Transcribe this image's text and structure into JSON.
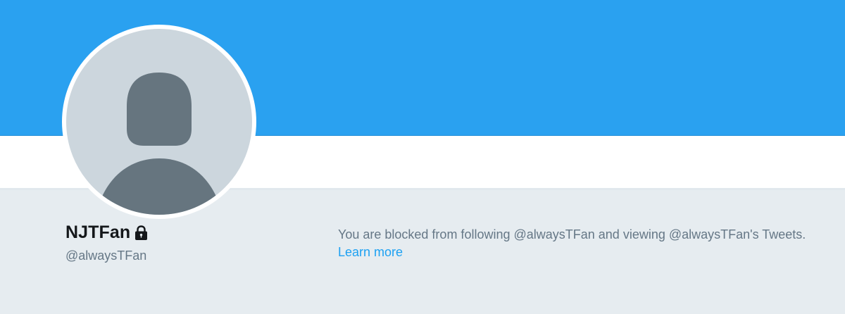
{
  "profile": {
    "name": "NJTFan",
    "handle": "@alwaysTFan",
    "protected_icon": "lock-icon",
    "avatar_icon": "default-profile-silhouette"
  },
  "blocked": {
    "message": "You are blocked from following @alwaysTFan and viewing @alwaysTFan's Tweets. ",
    "link_label": "Learn more"
  },
  "colors": {
    "banner": "#2aa1f0",
    "background": "#e6ecf0",
    "avatar_bg": "#ccd6dd",
    "silhouette": "#66757f",
    "link": "#1da1f2",
    "secondary_text": "#657786",
    "primary_text": "#14171a"
  }
}
